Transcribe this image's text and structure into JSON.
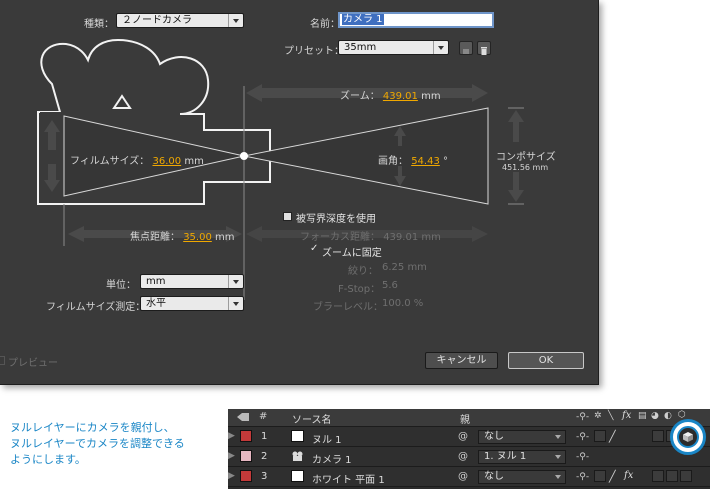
{
  "dialog": {
    "type_label": "種類：",
    "type_value": "２ノードカメラ",
    "name_label": "名前：",
    "name_value": "カメラ 1",
    "preset_label": "プリセット：",
    "preset_value": "35mm",
    "zoom_label": "ズーム：",
    "zoom_value": "439.01",
    "zoom_unit": "mm",
    "film_size_label": "フィルムサイズ：",
    "film_size_value": "36.00",
    "film_size_unit": "mm",
    "angle_label": "画角：",
    "angle_value": "54.43",
    "angle_unit": "°",
    "comp_size_label": "コンポサイズ",
    "comp_size_value": "451.56 mm",
    "dof_label": "被写界深度を使用",
    "focal_length_label": "焦点距離：",
    "focal_length_value": "35.00",
    "focal_length_unit": "mm",
    "focus_distance_label": "フォーカス距離：",
    "focus_distance_value": "439.01 mm",
    "lock_zoom_label": "ズームに固定",
    "aperture_label": "絞り：",
    "aperture_value": "6.25 mm",
    "fstop_label": "F-Stop：",
    "fstop_value": "5.6",
    "blur_label": "ブラーレベル：",
    "blur_value": "100.0 %",
    "units_label": "単位：",
    "units_value": "mm",
    "film_measure_label": "フィルムサイズ測定：",
    "film_measure_value": "水平",
    "preview_label": "プレビュー",
    "cancel_label": "キャンセル",
    "ok_label": "OK"
  },
  "caption": {
    "line1": "ヌルレイヤーにカメラを親付し、",
    "line2": "ヌルレイヤーでカメラを調整できる",
    "line3": "ようにします。"
  },
  "timeline": {
    "col_num": "#",
    "col_source": "ソース名",
    "col_parent": "親",
    "switch_fx": "fx",
    "layers": [
      {
        "num": "1",
        "name": "ヌル 1",
        "parent": "なし",
        "label_color": "#c43a3a"
      },
      {
        "num": "2",
        "name": "カメラ 1",
        "parent": "1. ヌル 1",
        "label_color": "#e6b7c2"
      },
      {
        "num": "3",
        "name": "ホワイト 平面 1",
        "parent": "なし",
        "label_color": "#c43a3a"
      }
    ],
    "highlight_color": "#1a86c6"
  }
}
